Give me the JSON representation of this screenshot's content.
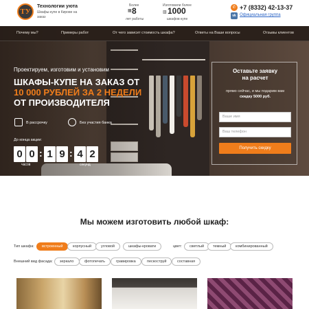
{
  "header": {
    "logo_text": "ТУ",
    "brand_name": "Технологии уюта",
    "brand_tagline": "Шкафы-купе в Кирове на заказ",
    "stat1": {
      "prefix": "Более",
      "number": "8",
      "suffix": "лет работы"
    },
    "stat2": {
      "prefix": "Изготовили более",
      "number": "1000",
      "suffix": "шкафов купе"
    },
    "phone": "+7 (8332) 42-13-37",
    "vk_label": "Официальная группа"
  },
  "nav": [
    "Почему мы?",
    "Примеры работ",
    "От чего зависит стоимость шкафа?",
    "Ответы на Ваши вопросы",
    "Отзывы клиентов"
  ],
  "hero": {
    "subtitle": "Проектируем, изготовим и установим",
    "title_line1": "Шкафы-купе на заказ от",
    "title_line2": "10 000 рублей за 2 недели",
    "title_line3": "от производителя",
    "feature1": "В рассрочку",
    "feature2": "Без участия банка",
    "timer_label": "До конца акции:",
    "timer": {
      "d1": "0",
      "d2": "0",
      "d3": "1",
      "d4": "9",
      "d5": "4",
      "d6": "2"
    },
    "timer_minutes_label": "часов",
    "timer_seconds_label": "секунд"
  },
  "form": {
    "title_line1": "Оставьте заявку",
    "title_line2": "на расчет",
    "note_line1": "прямо сейчас, и мы подарим вам",
    "note_line2": "скидку 5000 руб.",
    "name_placeholder": "Ваше имя",
    "phone_placeholder": "Ваш телефон",
    "submit_label": "Получить скидку"
  },
  "section": {
    "title": "Мы можем изготовить любой шкаф:",
    "type_label": "Тип шкафа:",
    "types": [
      "встроенный",
      "корпусный",
      "угловой",
      "шкафы-кровати"
    ],
    "color_label": "цвет:",
    "colors": [
      "светлый",
      "темный",
      "комбинированный"
    ],
    "facade_label": "Внешний вид фасада:",
    "facades": [
      "зеркало",
      "фотопечать",
      "гравировка",
      "пескоструй",
      "составная"
    ]
  },
  "colors": {
    "accent": "#f07d1b",
    "nav_bg": "#2a1f1a",
    "vk": "#4a76a8"
  }
}
